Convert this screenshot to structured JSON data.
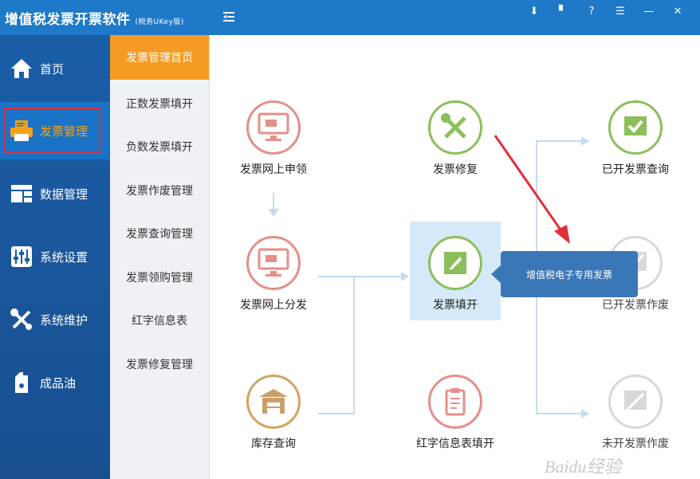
{
  "app": {
    "title": "增值税发票开票软件",
    "subtitle": "(税务UKey版)"
  },
  "window_controls": [
    "download-icon",
    "bookmark-icon",
    "help-icon",
    "menu-icon",
    "minimize-icon",
    "close-icon"
  ],
  "window_control_glyphs": [
    "⬇",
    "▘",
    "?",
    "☰",
    "—",
    "✕"
  ],
  "leftnav": {
    "items": [
      {
        "label": "首页",
        "icon": "home-icon"
      },
      {
        "label": "发票管理",
        "icon": "invoice-printer-icon",
        "active": true
      },
      {
        "label": "数据管理",
        "icon": "data-icon"
      },
      {
        "label": "系统设置",
        "icon": "settings-sliders-icon"
      },
      {
        "label": "系统维护",
        "icon": "tools-icon"
      },
      {
        "label": "成品油",
        "icon": "oil-can-icon"
      }
    ]
  },
  "submenu": {
    "items": [
      {
        "label": "发票管理首页",
        "active": true
      },
      {
        "label": "正数发票填开"
      },
      {
        "label": "负数发票填开"
      },
      {
        "label": "发票作废管理"
      },
      {
        "label": "发票查询管理"
      },
      {
        "label": "发票领购管理"
      },
      {
        "label": "红字信息表"
      },
      {
        "label": "发票修复管理"
      }
    ]
  },
  "flow": {
    "nodes": {
      "apply_online": "发票网上申领",
      "distribute_online": "发票网上分发",
      "stock_query": "库存查询",
      "repair": "发票修复",
      "issue": "发票填开",
      "red_info_fill": "红字信息表填开",
      "issued_query": "已开发票查询",
      "issued_void": "已开发票作废",
      "unissued_void": "未开发票作废"
    },
    "tooltip": "增值税电子专用发票"
  },
  "watermark": "Baidu经验",
  "colors": {
    "titlebar": "#1e79c9",
    "nav_bg": "#1a5ea8",
    "active_sub": "#f59a23",
    "annotation_red": "#e0303a",
    "pink_circle": "#e58f88",
    "green_circle": "#8cbf5a",
    "tan_circle": "#d2a45e"
  }
}
